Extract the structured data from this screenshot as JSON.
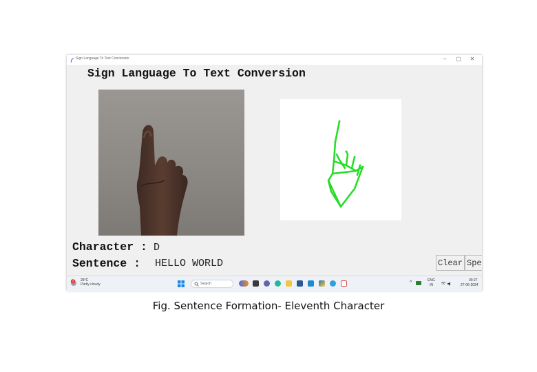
{
  "window": {
    "title": "Sign Language To Text Conversion",
    "controls": {
      "minimize": "–",
      "maximize": "▢",
      "close": "✕"
    }
  },
  "app": {
    "heading": "Sign Language To Text Conversion",
    "character_label": "Character :",
    "character_value": "D",
    "sentence_label": "Sentence :",
    "sentence_value": "HELLO WORLD",
    "buttons": {
      "clear": "Clear",
      "speak": "Speak"
    }
  },
  "colors": {
    "skeleton": "#22dd22",
    "taskbar": "#eef2f7",
    "window_bg": "#f0f0f0"
  },
  "taskbar": {
    "weather_temp": "26°C",
    "weather_desc": "Partly cloudy",
    "weather_badge": "1",
    "search_placeholder": "Search",
    "icons": [
      "windows-start-icon",
      "search-icon",
      "widget-icon",
      "file-explorer-icon",
      "chat-icon",
      "edge-icon",
      "folder-icon",
      "store-icon",
      "vscode-icon",
      "python-icon",
      "telegram-icon",
      "feather-icon"
    ],
    "tray_arrow": "^",
    "lang_top": "ENG",
    "lang_bottom": "IN",
    "time": "00:27",
    "date": "27-06-2024"
  },
  "caption": "Fig. Sentence Formation- Eleventh Character"
}
